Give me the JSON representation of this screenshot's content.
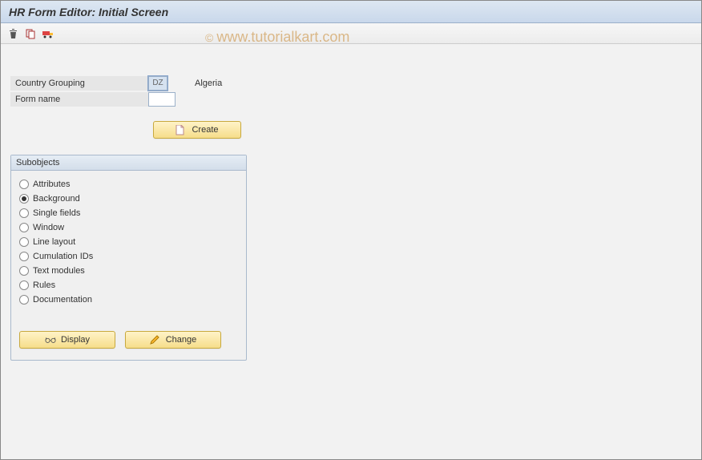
{
  "title": "HR Form Editor: Initial Screen",
  "watermark": "www.tutorialkart.com",
  "fields": {
    "country_grouping_label": "Country Grouping",
    "country_grouping_code": "DZ",
    "country_grouping_text": "Algeria",
    "form_name_label": "Form name",
    "form_name_value": ""
  },
  "buttons": {
    "create": "Create",
    "display": "Display",
    "change": "Change"
  },
  "groupbox": {
    "title": "Subobjects",
    "selected": 1,
    "options": [
      "Attributes",
      "Background",
      "Single fields",
      "Window",
      "Line layout",
      "Cumulation IDs",
      "Text modules",
      "Rules",
      "Documentation"
    ]
  }
}
